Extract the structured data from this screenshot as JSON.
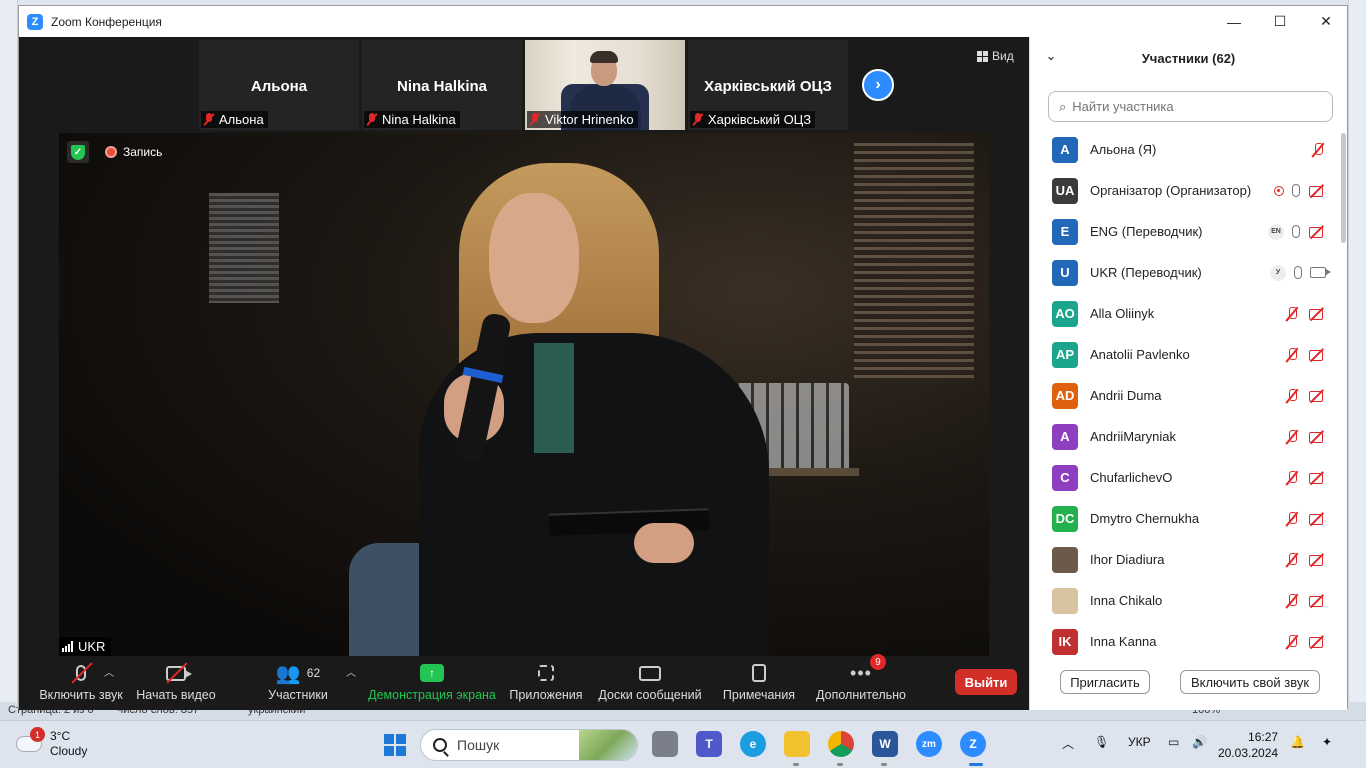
{
  "window": {
    "title": "Zoom Конференция",
    "minimize": "—",
    "maximize": "☐",
    "close": "✕"
  },
  "word_status": {
    "page": "Страница: 2 из 6",
    "words": "Число слов: 857",
    "lang": "украинский",
    "zoom": "100%"
  },
  "thumbnails": [
    {
      "big_name": "Альона",
      "label": "Альона",
      "video": false
    },
    {
      "big_name": "Nina Halkina",
      "label": "Nina Halkina",
      "video": false
    },
    {
      "big_name": "",
      "label": "Viktor Hrinenko",
      "video": true
    },
    {
      "big_name": "Харківський ОЦЗ",
      "label": "Харківський ОЦЗ",
      "video": false
    }
  ],
  "view_label": "Вид",
  "main_video": {
    "recording_label": "Запись",
    "speaker_label": "UKR"
  },
  "toolbar": {
    "audio": "Включить звук",
    "video": "Начать видео",
    "participants": "Участники",
    "participants_count": "62",
    "share": "Демонстрация экрана",
    "apps": "Приложения",
    "whiteboards": "Доски сообщений",
    "notes": "Примечания",
    "more": "Дополнительно",
    "more_badge": "9",
    "leave": "Выйти"
  },
  "panel": {
    "title": "Участники (62)",
    "search_placeholder": "Найти участника",
    "invite": "Пригласить",
    "unmute_self": "Включить свой звук",
    "participants": [
      {
        "initials": "A",
        "name": "Альона (Я)",
        "color": "#2268b8",
        "icons": [
          "micoff"
        ]
      },
      {
        "initials": "UA",
        "name": "Організатор (Организатор)",
        "color": "#3b3b3b",
        "icons": [
          "rec",
          "mic",
          "camoff"
        ]
      },
      {
        "initials": "E",
        "name": "ENG (Переводчик)",
        "color": "#2268b8",
        "lang": "EN",
        "icons": [
          "lang",
          "mic",
          "camoff"
        ]
      },
      {
        "initials": "U",
        "name": "UKR (Переводчик)",
        "color": "#2268b8",
        "lang": "У",
        "icons": [
          "lang",
          "mic",
          "cam"
        ]
      },
      {
        "initials": "AO",
        "name": "Alla Oliinyk",
        "color": "#1aa58c",
        "icons": [
          "micoff",
          "camoff"
        ]
      },
      {
        "initials": "AP",
        "name": "Anatolii Pavlenko",
        "color": "#1aa58c",
        "icons": [
          "micoff",
          "camoff"
        ]
      },
      {
        "initials": "AD",
        "name": "Andrii Duma",
        "color": "#e06010",
        "icons": [
          "micoff",
          "camoff"
        ]
      },
      {
        "initials": "A",
        "name": "AndriiMaryniak",
        "color": "#8e3fbf",
        "icons": [
          "micoff",
          "camoff"
        ]
      },
      {
        "initials": "C",
        "name": "ChufarlichevO",
        "color": "#8e3fbf",
        "icons": [
          "micoff",
          "camoff"
        ]
      },
      {
        "initials": "DC",
        "name": "Dmytro Chernukha",
        "color": "#23b14d",
        "icons": [
          "micoff",
          "camoff"
        ]
      },
      {
        "initials": "",
        "name": "Ihor Diadiura",
        "color": "#6b5a4a",
        "icons": [
          "micoff",
          "camoff"
        ]
      },
      {
        "initials": "",
        "name": "Inna Chikalo",
        "color": "#d9c4a2",
        "icons": [
          "micoff",
          "camoff"
        ]
      },
      {
        "initials": "IK",
        "name": "Inna Kanna",
        "color": "#c03030",
        "icons": [
          "micoff",
          "camoff"
        ]
      }
    ]
  },
  "taskbar": {
    "weather_temp": "3°C",
    "weather_desc": "Cloudy",
    "weather_badge": "1",
    "search_placeholder": "Пошук",
    "lang": "УКР",
    "time": "16:27",
    "date": "20.03.2024"
  }
}
